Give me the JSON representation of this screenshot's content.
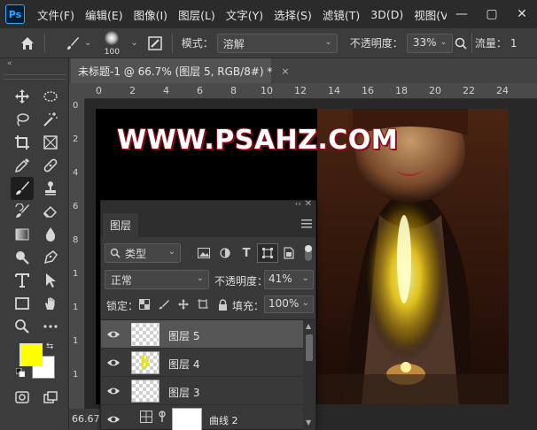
{
  "app": {
    "logo": "Ps"
  },
  "menu": [
    "文件(F)",
    "编辑(E)",
    "图像(I)",
    "图层(L)",
    "文字(Y)",
    "选择(S)",
    "滤镜(T)",
    "3D(D)",
    "视图(V)",
    "窗"
  ],
  "window_buttons": {
    "minimize": "—",
    "maximize": "▢",
    "close": "✕"
  },
  "options": {
    "brush_size": "100",
    "mode_label": "模式：",
    "mode_value": "溶解",
    "opacity_label": "不透明度：",
    "opacity_value": "33%",
    "flow_label": "流量：",
    "flow_value": "1"
  },
  "document": {
    "tab_title": "未标题-1 @ 66.7% (图层 5, RGB/8#) *",
    "close": "×",
    "zoom_status": "66.67%",
    "watermark": "WWW.PSAHZ.COM",
    "ruler_labels": [
      "0",
      "2",
      "4",
      "6",
      "8",
      "10",
      "12",
      "14",
      "16",
      "18",
      "20",
      "22",
      "24"
    ],
    "ruler_v_labels": [
      "0",
      "2",
      "4",
      "6",
      "8",
      "1",
      "1",
      "1",
      "1"
    ]
  },
  "colors": {
    "foreground": "#ffff00",
    "background": "#ffffff",
    "accent": "#31a8ff"
  },
  "layers_panel": {
    "collapse": "‹‹",
    "close": "✕",
    "tab": "图层",
    "filter_value": "类型",
    "blend_mode": "正常",
    "opacity_label": "不透明度：",
    "opacity_value": "41%",
    "lock_label": "锁定：",
    "fill_label": "填充：",
    "fill_value": "100%",
    "layers": [
      {
        "name": "图层 5",
        "selected": true
      },
      {
        "name": "图层 4",
        "selected": false
      },
      {
        "name": "图层 3",
        "selected": false
      },
      {
        "name": "曲线 2",
        "selected": false
      }
    ]
  },
  "icons": {
    "toolbar": [
      "move-icon",
      "marquee-icon",
      "lasso-icon",
      "magic-wand-icon",
      "crop-icon",
      "frame-icon",
      "eyedropper-icon",
      "healing-icon",
      "brush-icon",
      "stamp-icon",
      "history-brush-icon",
      "eraser-icon",
      "gradient-icon",
      "blur-icon",
      "dodge-icon",
      "pen-icon",
      "type-icon",
      "path-select-icon",
      "rectangle-icon",
      "hand-icon",
      "zoom-icon",
      "more-icon"
    ]
  }
}
